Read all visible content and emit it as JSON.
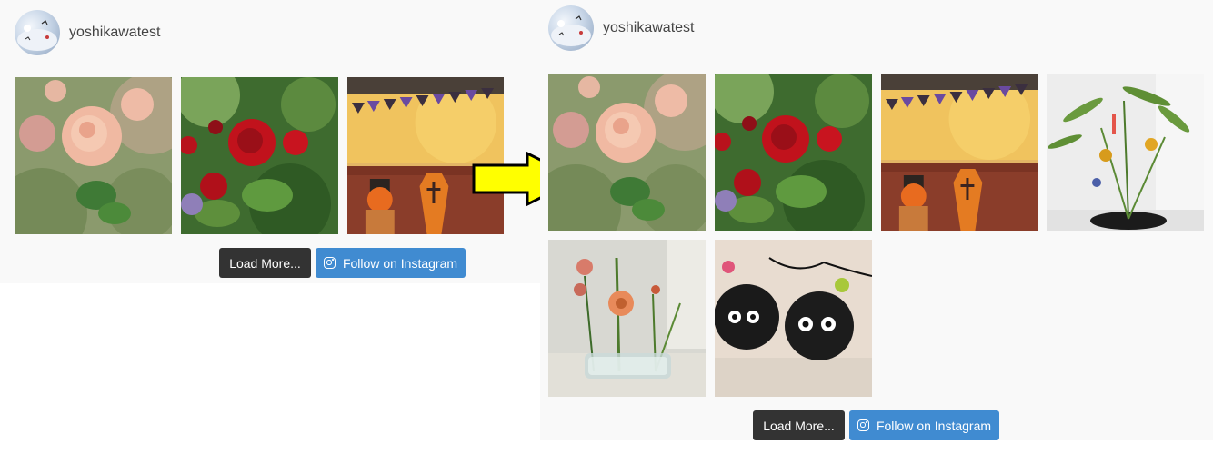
{
  "before": {
    "username": "yoshikawatest",
    "photos": [
      "pink-rose-photo",
      "red-rose-photo",
      "halloween-photo"
    ],
    "load_more_label": "Load More...",
    "follow_label": "Follow on Instagram"
  },
  "after": {
    "username": "yoshikawatest",
    "photos": [
      "pink-rose-photo",
      "red-rose-photo",
      "halloween-photo",
      "bamboo-ikebana-photo",
      "flower-vase-photo",
      "soot-sprite-photo"
    ],
    "load_more_label": "Load More...",
    "follow_label": "Follow on Instagram"
  },
  "arrow": {
    "icon": "arrow-right-icon",
    "fill": "#ffff00",
    "stroke": "#000000"
  },
  "colors": {
    "load_button": "#333333",
    "follow_button": "#408bd1",
    "feed_background": "#f9f9f9"
  }
}
